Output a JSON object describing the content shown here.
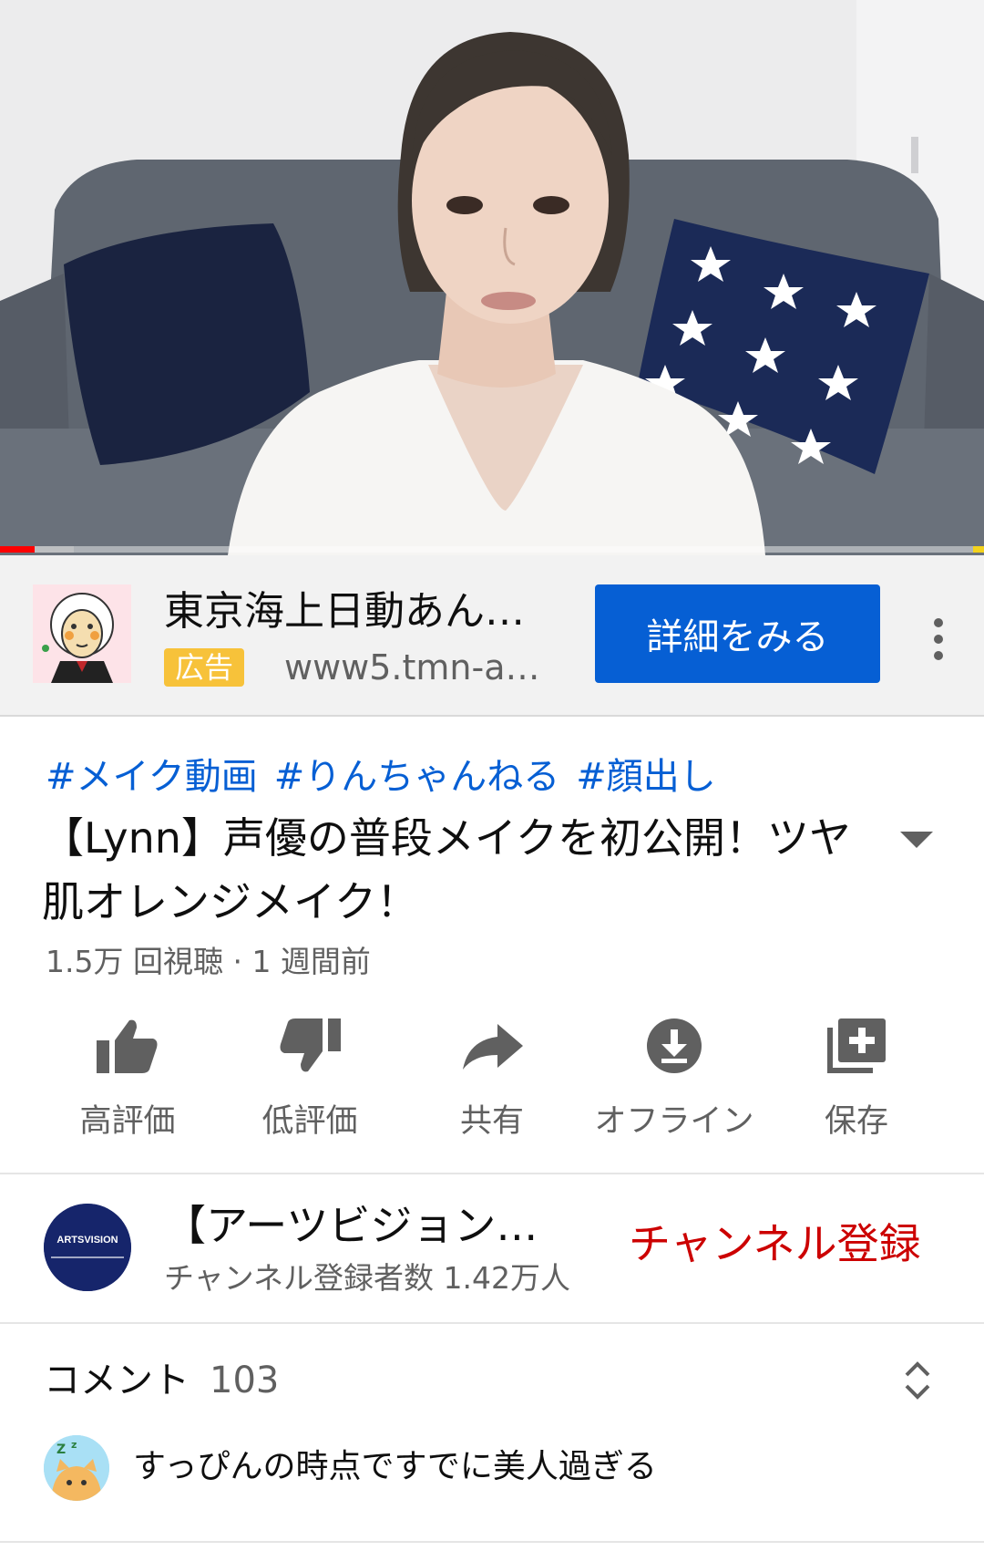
{
  "video": {
    "progress_fraction": 0.035,
    "buffered_fraction": 0.075
  },
  "ad": {
    "title": "東京海上日動あん…",
    "badge": "広告",
    "url": "www5.tmn-an…",
    "cta_label": "詳細をみる",
    "more_icon": "more-vert-icon"
  },
  "video_info": {
    "hashtags": [
      "#メイク動画",
      "#りんちゃんねる",
      "#顔出し"
    ],
    "title": "【Lynn】声優の普段メイクを初公開！ツヤ肌オレンジメイク！",
    "meta": "1.5万 回視聴 · 1 週間前"
  },
  "actions": [
    {
      "label": "高評価",
      "icon": "thumb-up-icon"
    },
    {
      "label": "低評価",
      "icon": "thumb-down-icon"
    },
    {
      "label": "共有",
      "icon": "share-icon"
    },
    {
      "label": "オフライン",
      "icon": "download-icon"
    },
    {
      "label": "保存",
      "icon": "add-to-playlist-icon"
    }
  ],
  "channel": {
    "name": "【アーツビジョン…",
    "subscribers": "チャンネル登録者数 1.42万人",
    "subscribe_label": "チャンネル登録",
    "avatar_text": "ARTSVISION"
  },
  "comments": {
    "label": "コメント",
    "count": "103",
    "first_comment": "すっぴんの時点ですでに美人過ぎる"
  },
  "colors": {
    "accent_blue": "#065fd4",
    "subscribe_red": "#cc0000",
    "ad_badge_yellow": "#f7c23a",
    "progress_red": "#ff0000"
  }
}
